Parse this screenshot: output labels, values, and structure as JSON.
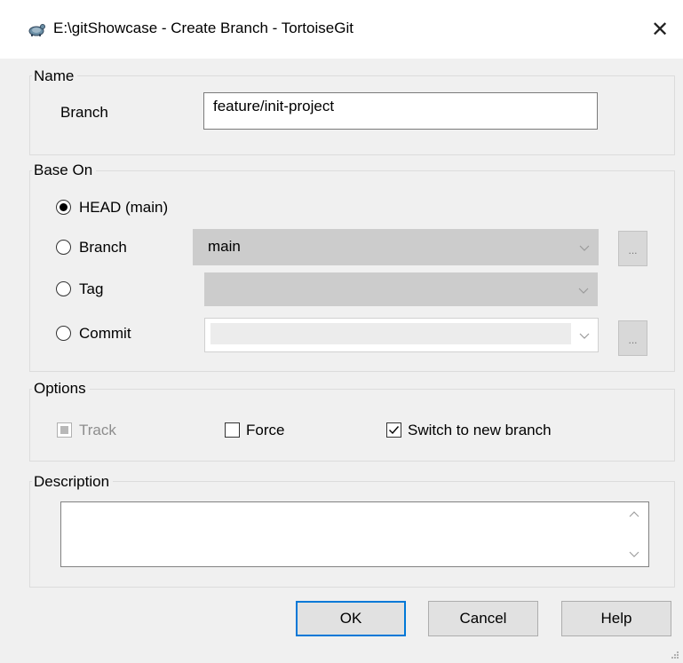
{
  "window": {
    "title": "E:\\gitShowcase - Create Branch - TortoiseGit",
    "close_glyph": "✕"
  },
  "name_group": {
    "label": "Name",
    "branch_label": "Branch",
    "branch_value": "feature/init-project"
  },
  "base_on": {
    "label": "Base On",
    "head_label": "HEAD (main)",
    "branch_label": "Branch",
    "branch_value": "main",
    "tag_label": "Tag",
    "commit_label": "Commit",
    "browse_glyph": "...",
    "selected": "HEAD (main)"
  },
  "options": {
    "label": "Options",
    "track_label": "Track",
    "force_label": "Force",
    "switch_label": "Switch to new branch",
    "track_state": "indeterminate-disabled",
    "force_checked": false,
    "switch_checked": true
  },
  "description": {
    "label": "Description"
  },
  "buttons": {
    "ok": "OK",
    "cancel": "Cancel",
    "help": "Help"
  },
  "icons": [
    "tortoise-icon",
    "close-icon",
    "chevron-down-icon",
    "chevron-up-icon",
    "check-icon",
    "resize-grip-icon"
  ],
  "colors": {
    "accent": "#0078d7",
    "dialog_bg": "#f0f0f0",
    "disabled_combo": "#cccccc"
  }
}
